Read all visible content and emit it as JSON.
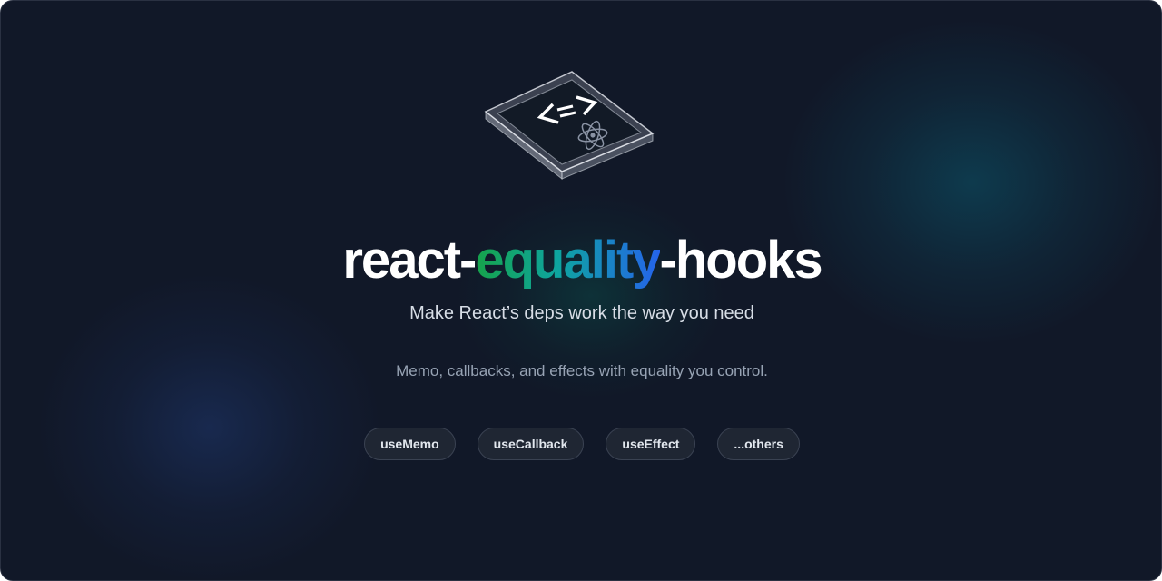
{
  "hero": {
    "title_prefix": "react-",
    "title_accent": "equality",
    "title_suffix": "-hooks",
    "subtitle": "Make React’s deps work the way you need",
    "tagline": "Memo, callbacks, and effects with equality you control."
  },
  "pills": [
    "useMemo",
    "useCallback",
    "useEffect",
    "...others"
  ],
  "logo": {
    "glyph": "<=>",
    "icons": [
      "transparent-box-icon",
      "equality-arrows-icon",
      "react-atom-icon"
    ]
  },
  "colors": {
    "background": "#111828",
    "accent_start": "#16a34a",
    "accent_end": "#2563eb",
    "pill_background": "#1f2633",
    "text_primary": "#ffffff"
  }
}
